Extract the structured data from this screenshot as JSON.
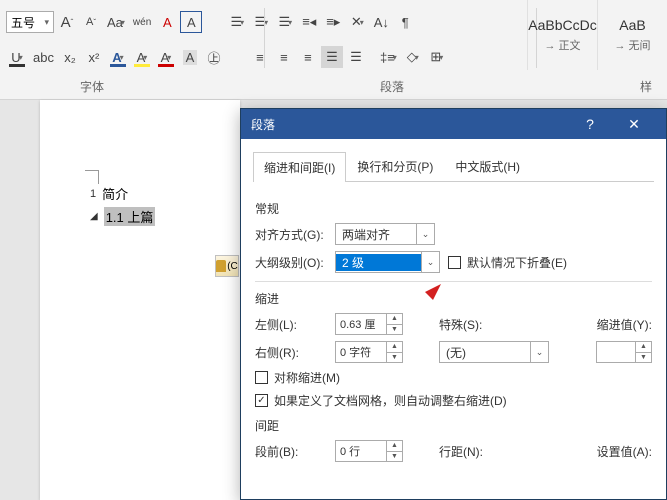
{
  "ribbon": {
    "font_size": "五号",
    "grow": "A",
    "shrink": "A",
    "change_case": "Aa",
    "phonetic": "wén",
    "clear_fmt": "A",
    "border_char": "A",
    "underline": "U",
    "strike": "abc",
    "sub": "x₂",
    "sup": "x²",
    "text_effect": "A",
    "highlight": "A",
    "font_color": "A",
    "char_shade": "A",
    "enclose": "㊤",
    "group_font": "字体",
    "group_para": "段落",
    "group_style": "样",
    "styles": [
      {
        "preview": "AaBbCcDc",
        "name": "→ 正文"
      },
      {
        "preview": "AaB",
        "name": "→ 无间"
      }
    ]
  },
  "doc": {
    "line1_num": "1",
    "line1_text": "简介",
    "line2_text": "1.1  上篇",
    "paste_hint": "(C"
  },
  "dialog": {
    "title": "段落",
    "tabs": [
      "缩进和间距(I)",
      "换行和分页(P)",
      "中文版式(H)"
    ],
    "section_general": "常规",
    "label_align": "对齐方式(G):",
    "val_align": "两端对齐",
    "label_outline": "大纲级别(O):",
    "val_outline": "2 级",
    "check_collapse": "默认情况下折叠(E)",
    "section_indent": "缩进",
    "label_left": "左侧(L):",
    "val_left": "0.63 厘",
    "label_special": "特殊(S):",
    "label_indent_val": "缩进值(Y):",
    "label_right": "右侧(R):",
    "val_right": "0 字符",
    "val_special": "(无)",
    "check_mirror": "对称缩进(M)",
    "check_grid": "如果定义了文档网格，则自动调整右缩进(D)",
    "section_spacing": "间距",
    "label_before": "段前(B):",
    "val_before": "0 行",
    "label_linespace": "行距(N):",
    "label_setval": "设置值(A):"
  }
}
